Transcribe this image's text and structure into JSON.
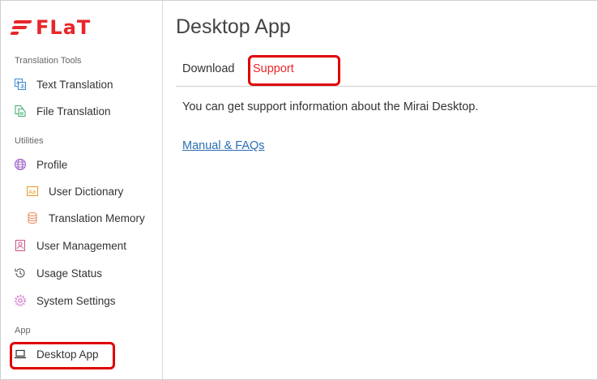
{
  "brand": {
    "logo_text": "FLaT",
    "accent": "#e8262b"
  },
  "sidebar": {
    "sections": [
      {
        "label": "Translation Tools"
      },
      {
        "label": "Utilities"
      },
      {
        "label": "App"
      }
    ],
    "items": [
      {
        "label": "Text Translation",
        "icon": "text-translation-icon"
      },
      {
        "label": "File Translation",
        "icon": "file-translation-icon"
      },
      {
        "label": "Profile",
        "icon": "globe-icon"
      },
      {
        "label": "User Dictionary",
        "icon": "dictionary-icon"
      },
      {
        "label": "Translation Memory",
        "icon": "database-icon"
      },
      {
        "label": "User Management",
        "icon": "user-card-icon"
      },
      {
        "label": "Usage Status",
        "icon": "history-icon"
      },
      {
        "label": "System Settings",
        "icon": "gear-icon"
      },
      {
        "label": "Desktop App",
        "icon": "laptop-icon"
      }
    ]
  },
  "main": {
    "title": "Desktop App",
    "tabs": [
      {
        "label": "Download"
      },
      {
        "label": "Support"
      }
    ],
    "body_text": "You can get support information about the Mirai Desktop.",
    "link_text": "Manual & FAQs"
  }
}
